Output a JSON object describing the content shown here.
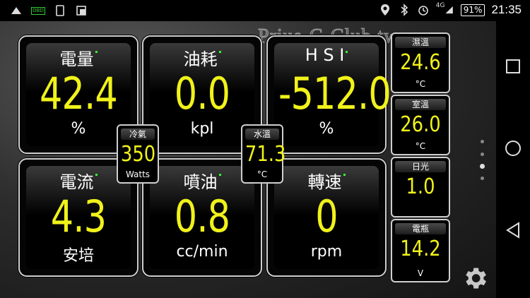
{
  "status_bar": {
    "left_icons": [
      "app-icon",
      "obd-icon",
      "tablet-icon",
      "screenshot-icon"
    ],
    "obd_text": "OBD",
    "network": "4G",
    "battery": "91%",
    "time": "21:35"
  },
  "watermark": "Prius-C-Club.tw",
  "panels": [
    {
      "label": "電量",
      "value": "42.4",
      "unit": "%"
    },
    {
      "label": "油耗",
      "value": "0.0",
      "unit": "kpl"
    },
    {
      "label": "H S I",
      "value": "-512.0",
      "unit": "%"
    },
    {
      "label": "電流",
      "value": "4.3",
      "unit": "安培"
    },
    {
      "label": "噴油",
      "value": "0.8",
      "unit": "cc/min"
    },
    {
      "label": "轉速",
      "value": "0",
      "unit": "rpm"
    }
  ],
  "small_gauges": [
    {
      "label": "冷氣",
      "value": "350",
      "unit": "Watts"
    },
    {
      "label": "水溫",
      "value": "71.3",
      "unit": "°C"
    },
    {
      "label": "濕溫",
      "value": "24.6",
      "unit": "°C"
    },
    {
      "label": "室溫",
      "value": "26.0",
      "unit": "°C"
    },
    {
      "label": "日光",
      "value": "1.0",
      "unit": ""
    },
    {
      "label": "電瓶",
      "value": "14.2",
      "unit": "V"
    }
  ],
  "page_indicator": {
    "pages": 4,
    "active": 3
  },
  "navigation": [
    "recents-button",
    "home-button",
    "back-button"
  ]
}
